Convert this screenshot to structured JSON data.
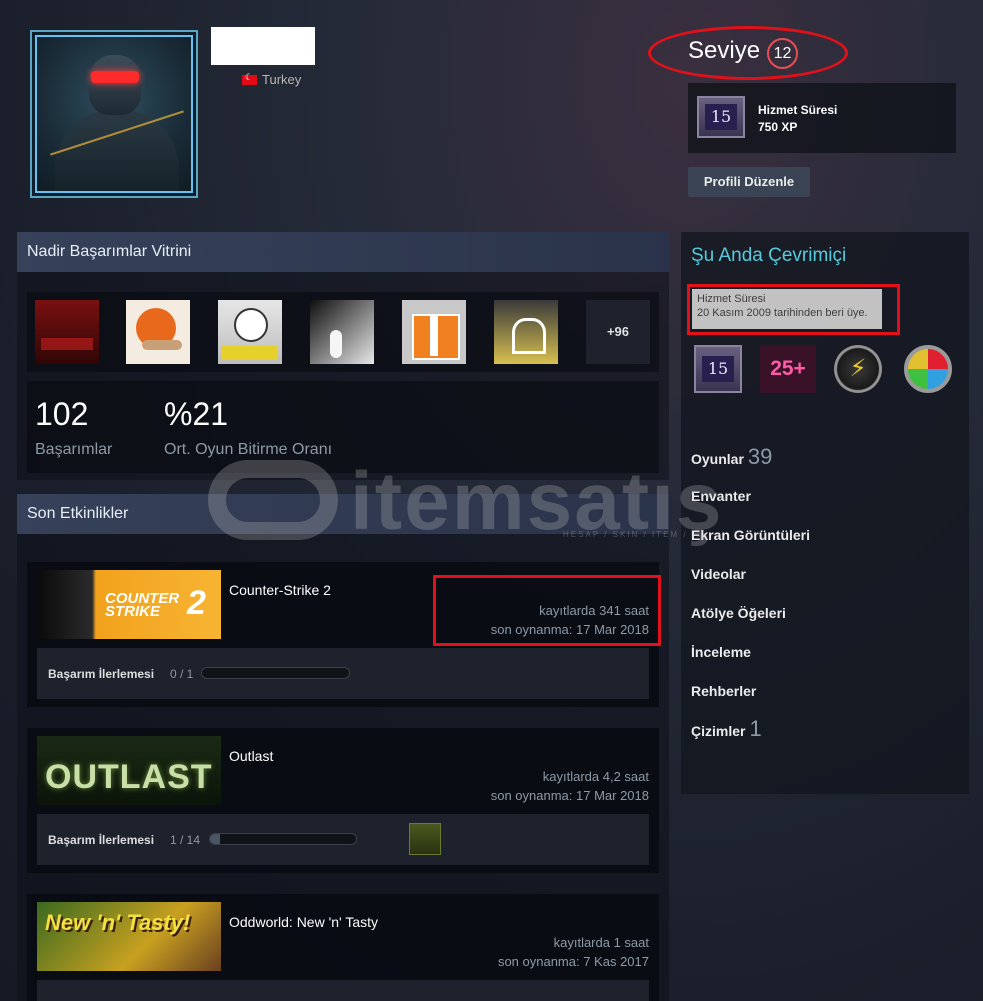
{
  "profile": {
    "country": "Turkey",
    "level_label": "Seviye",
    "level": "12",
    "xp_badge_number": "15",
    "xp_badge_title": "Hizmet Süresi",
    "xp_value": "750 XP",
    "edit_button": "Profili Düzenle"
  },
  "showcase": {
    "title": "Nadir Başarımlar Vitrini",
    "more_label": "+96",
    "achievements_count": "102",
    "achievements_label": "Başarımlar",
    "completion_rate": "%21",
    "completion_label": "Ort. Oyun Bitirme Oranı",
    "icons": [
      "red-building-icon",
      "orange-fox-icon",
      "apple-icon",
      "hook-icon",
      "gift-box-icon",
      "pickaxe-icon"
    ]
  },
  "recent": {
    "title": "Son Etkinlikler",
    "games": [
      {
        "name": "Counter-Strike 2",
        "hours": "kayıtlarda 341 saat",
        "last_played": "son oynanma: 17 Mar 2018",
        "progress_label": "Başarım İlerlemesi",
        "progress_count": "0 / 1",
        "progress_fraction": 0.0,
        "cover_text_1": "COUNTER",
        "cover_text_2": "STRIKE",
        "cover_text_3": "2"
      },
      {
        "name": "Outlast",
        "hours": "kayıtlarda 4,2 saat",
        "last_played": "son oynanma: 17 Mar 2018",
        "progress_label": "Başarım İlerlemesi",
        "progress_count": "1 / 14",
        "progress_fraction": 0.071,
        "cover_text_1": "OUTLAST"
      },
      {
        "name": "Oddworld: New 'n' Tasty",
        "hours": "kayıtlarda 1 saat",
        "last_played": "son oynanma: 7 Kas 2017",
        "cover_text_1": "New 'n' Tasty!"
      }
    ]
  },
  "sidebar": {
    "online_title": "Şu Anda Çevrimiçi",
    "tooltip_line1": "Hizmet Süresi",
    "tooltip_line2": "20 Kasım 2009 tarihinden beri üye.",
    "badges": [
      {
        "text": "15",
        "icon": "years-of-service-badge"
      },
      {
        "text": "25+",
        "icon": "25-plus-badge"
      },
      {
        "text": "⚡",
        "icon": "lightning-badge"
      },
      {
        "text": "",
        "icon": "colorful-medal-badge"
      }
    ],
    "nav": [
      {
        "label": "Oyunlar",
        "count": "39"
      },
      {
        "label": "Envanter",
        "count": ""
      },
      {
        "label": "Ekran Görüntüleri",
        "count": ""
      },
      {
        "label": "Videolar",
        "count": ""
      },
      {
        "label": "Atölye Öğeleri",
        "count": ""
      },
      {
        "label": "İnceleme",
        "count": ""
      },
      {
        "label": "Rehberler",
        "count": ""
      },
      {
        "label": "Çizimler",
        "count": "1"
      }
    ]
  },
  "watermark": {
    "text": "itemsatış",
    "sub": "HESAP / SKIN / ITEM / ..."
  },
  "colors": {
    "accent_red": "#e0111a",
    "online_blue": "#57cbde"
  }
}
